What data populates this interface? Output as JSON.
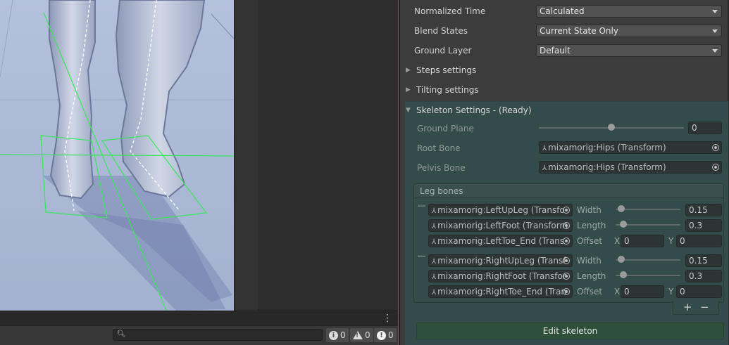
{
  "scene": {
    "colors": {
      "background": "#a9b7d5",
      "character": "#c3ccdf",
      "gizmo": "#39e65a"
    }
  },
  "console": {
    "search_placeholder": "",
    "info_count": "0",
    "warning_count": "0",
    "error_count": "0"
  },
  "inspector": {
    "normalized_time": {
      "label": "Normalized Time",
      "value": "Calculated"
    },
    "blend_states": {
      "label": "Blend States",
      "value": "Current State Only"
    },
    "ground_layer": {
      "label": "Ground Layer",
      "value": "Default"
    },
    "steps_settings": "Steps settings",
    "tilting_settings": "Tilting settings",
    "skeleton": {
      "title": "Skeleton Settings - (Ready)",
      "ground_plane": {
        "label": "Ground Plane",
        "value": "0",
        "slider": 0.5
      },
      "root_bone": {
        "label": "Root Bone",
        "value": "mixamorig:Hips (Transform)"
      },
      "pelvis_bone": {
        "label": "Pelvis Bone",
        "value": "mixamorig:Hips (Transform)"
      },
      "leg_bones": {
        "header": "Leg bones",
        "legs": [
          {
            "upper": "mixamorig:LeftUpLeg (Transfo",
            "foot": "mixamorig:LeftFoot (Transform",
            "toe": "mixamorig:LeftToe_End (Trans",
            "width_label": "Width",
            "width": "0.15",
            "width_slider": 0.03,
            "length_label": "Length",
            "length": "0.3",
            "length_slider": 0.06,
            "offset_label": "Offset",
            "x_label": "X",
            "x": "0",
            "y_label": "Y",
            "y": "0"
          },
          {
            "upper": "mixamorig:RightUpLeg (Transf",
            "foot": "mixamorig:RightFoot (Transfor",
            "toe": "mixamorig:RightToe_End (Tran",
            "width_label": "Width",
            "width": "0.15",
            "width_slider": 0.03,
            "length_label": "Length",
            "length": "0.3",
            "length_slider": 0.06,
            "offset_label": "Offset",
            "x_label": "X",
            "x": "0",
            "y_label": "Y",
            "y": "0"
          }
        ],
        "add": "+",
        "remove": "−"
      },
      "edit_button": "Edit skeleton"
    }
  }
}
